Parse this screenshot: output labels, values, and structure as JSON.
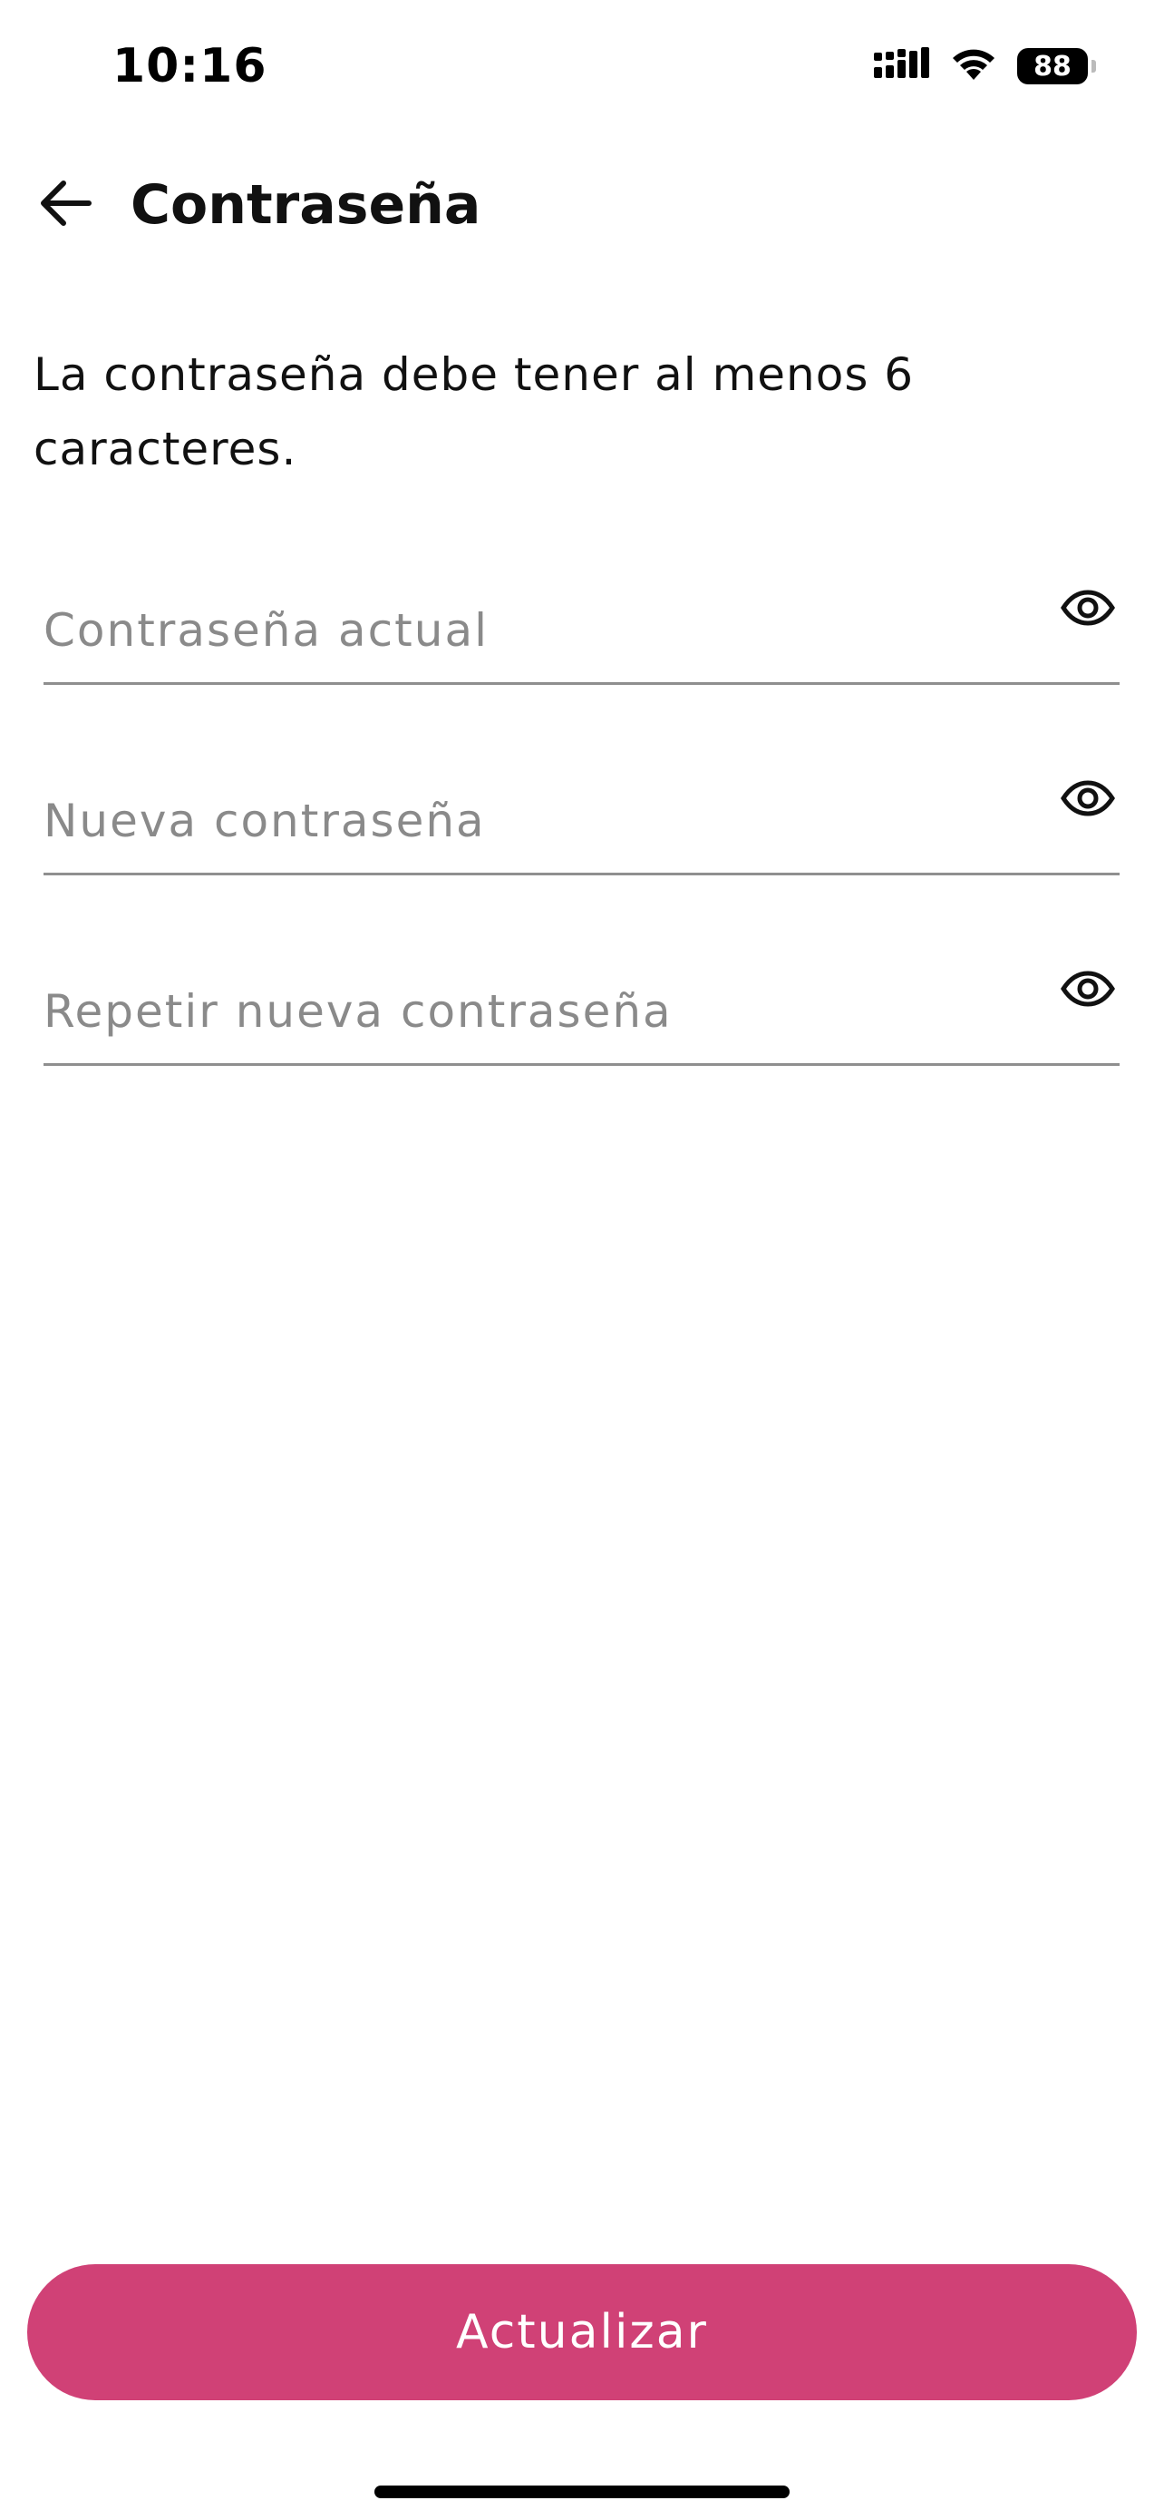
{
  "status_bar": {
    "time": "10:16",
    "battery": "88",
    "icons": [
      "cellular-signal-icon",
      "wifi-icon",
      "battery-icon"
    ]
  },
  "header": {
    "back_icon": "arrow-left-icon",
    "title": "Contraseña"
  },
  "description": "La contraseña debe tener al menos 6 caracteres.",
  "fields": [
    {
      "placeholder": "Contraseña actual",
      "value": "",
      "toggle_icon": "eye-icon"
    },
    {
      "placeholder": "Nueva contraseña",
      "value": "",
      "toggle_icon": "eye-icon"
    },
    {
      "placeholder": "Repetir nueva contraseña",
      "value": "",
      "toggle_icon": "eye-icon"
    }
  ],
  "submit_button": {
    "label": "Actualizar"
  },
  "colors": {
    "accent": "#d04176",
    "underline": "#8f8f8f",
    "placeholder": "#8a8a8a"
  }
}
